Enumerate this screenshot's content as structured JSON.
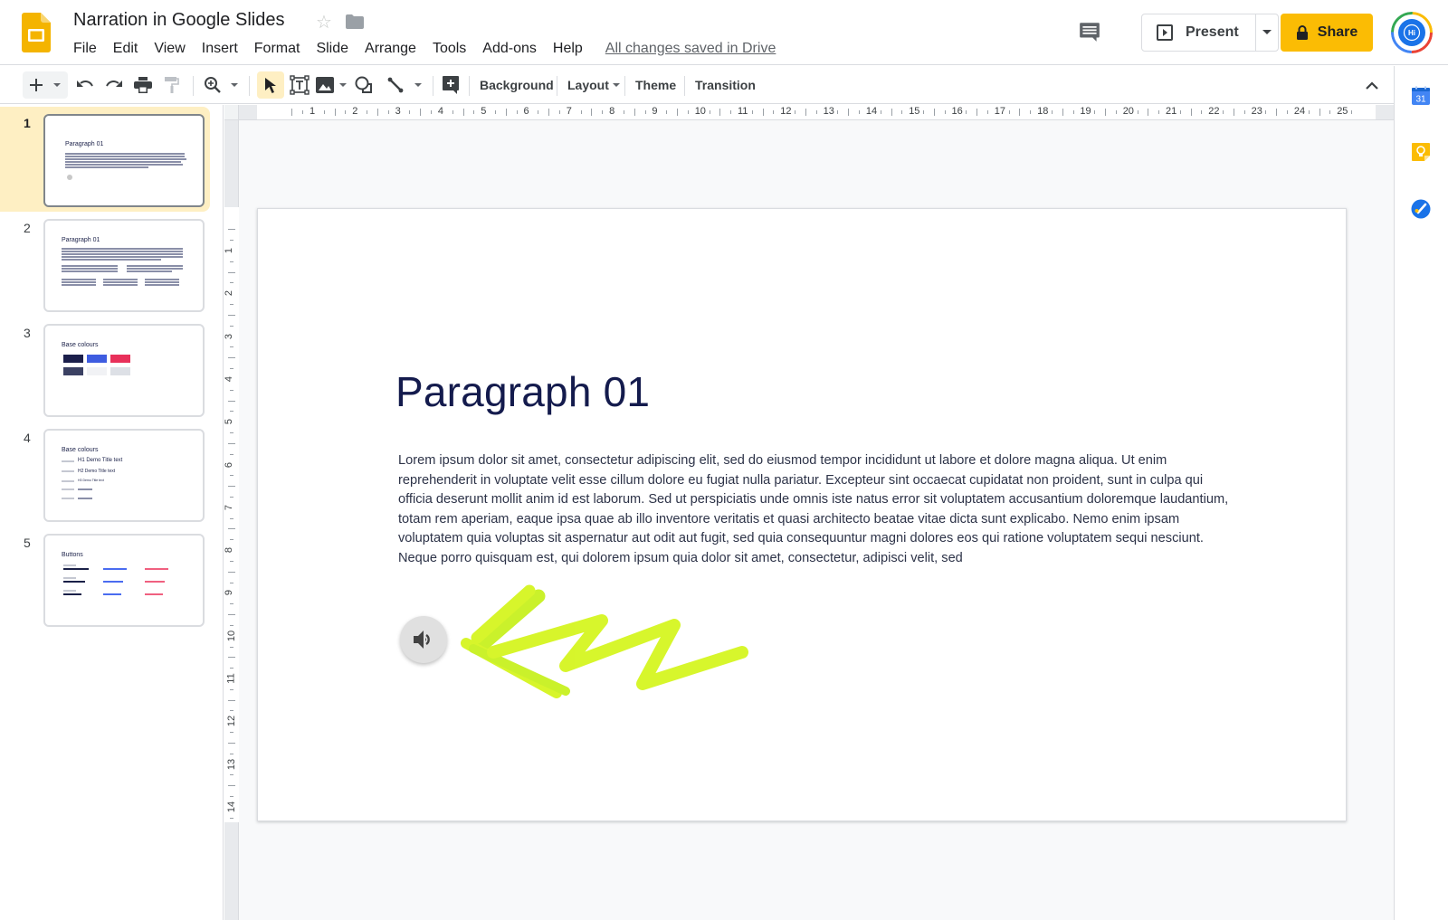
{
  "app": {
    "title": "Narration in Google Slides",
    "logo_icon": "google-slides-logo",
    "star_icon": "star-outline-icon",
    "folder_icon": "folder-icon"
  },
  "menu": {
    "items": [
      "File",
      "Edit",
      "View",
      "Insert",
      "Format",
      "Slide",
      "Arrange",
      "Tools",
      "Add-ons",
      "Help"
    ],
    "save_status": "All changes saved in Drive"
  },
  "header_actions": {
    "comment_icon": "comment-history-icon",
    "present_label": "Present",
    "present_dropdown_icon": "caret-down-icon",
    "share_label": "Share",
    "share_icon": "lock-icon",
    "avatar_text": "Hi"
  },
  "toolbar": {
    "buttons": [
      "new-slide",
      "new-slide-dropdown",
      "undo",
      "redo",
      "print",
      "paint-format",
      "zoom",
      "zoom-dropdown",
      "select",
      "text-box",
      "image",
      "image-dropdown",
      "shape",
      "line",
      "line-dropdown",
      "add-comment"
    ],
    "text_buttons": {
      "background": "Background",
      "layout": "Layout",
      "theme": "Theme",
      "transition": "Transition"
    },
    "active_tool": "select",
    "collapse_icon": "chevron-up-icon"
  },
  "side_panel": {
    "apps": [
      "Calendar",
      "Keep",
      "Tasks"
    ],
    "calendar_day": "31"
  },
  "rulers": {
    "horizontal": [
      "1",
      "2",
      "3",
      "4",
      "5",
      "6",
      "7",
      "8",
      "9",
      "10",
      "11",
      "12",
      "13",
      "14",
      "15",
      "16",
      "17",
      "18",
      "19",
      "20",
      "21",
      "22",
      "23",
      "24",
      "25"
    ],
    "vertical": [
      "1",
      "2",
      "3",
      "4",
      "5",
      "6",
      "7",
      "8",
      "9",
      "10",
      "11",
      "12",
      "13",
      "14"
    ]
  },
  "filmstrip": {
    "selected_index": 1,
    "slides": [
      {
        "number": "1",
        "title": "Paragraph 01",
        "kind": "paragraph-audio"
      },
      {
        "number": "2",
        "title": "Paragraph 01",
        "kind": "paragraph-columns"
      },
      {
        "number": "3",
        "title": "Base colours",
        "kind": "swatches",
        "swatches": [
          {
            "label": "#1B1F4B",
            "color": "#1b1f4b"
          },
          {
            "label": "#3E5CE0",
            "color": "#3e5ce0"
          },
          {
            "label": "#E8305A",
            "color": "#e8305a"
          },
          {
            "label": "#3B4163",
            "color": "#3b4163"
          },
          {
            "label": "#F1F2F5",
            "color": "#f1f2f5"
          },
          {
            "label": "#DDE0E6",
            "color": "#dde0e6"
          }
        ]
      },
      {
        "number": "4",
        "title": "Base colours",
        "kind": "headings",
        "headings": [
          "H1 Demo Title text",
          "H2 Demo Title text",
          "H3 Demo Title text"
        ]
      },
      {
        "number": "5",
        "title": "Buttons",
        "kind": "buttons"
      }
    ]
  },
  "slide": {
    "title": "Paragraph 01",
    "body_lines": [
      "Lorem ipsum dolor sit amet, consectetur adipiscing elit, sed do eiusmod tempor incididunt ut labore et dolore magna aliqua. Ut enim",
      "reprehenderit in voluptate velit esse cillum dolore eu fugiat nulla pariatur. Excepteur sint occaecat cupidatat non proident, sunt in culpa qui",
      "officia deserunt mollit anim id est laborum. Sed ut perspiciatis unde omnis iste natus error sit voluptatem accusantium doloremque laudantium,",
      "totam rem aperiam, eaque ipsa quae ab illo inventore veritatis et quasi architecto beatae vitae dicta sunt explicabo. Nemo enim ipsam",
      "voluptatem quia voluptas sit aspernatur aut odit aut fugit, sed quia consequuntur magni dolores eos qui ratione voluptatem sequi nesciunt.",
      "Neque porro quisquam est, qui dolorem ipsum quia dolor sit amet, consectetur, adipisci velit, sed"
    ],
    "audio_icon": "speaker-icon",
    "annotation": "highlighter-arrow-scribble",
    "annotation_color": "#d4f51a"
  },
  "colors": {
    "accent_yellow": "#fbbc04",
    "selected_slide_bg": "#feefc3",
    "slide_title_color": "#141b4d",
    "highlighter": "#d4f51a"
  }
}
